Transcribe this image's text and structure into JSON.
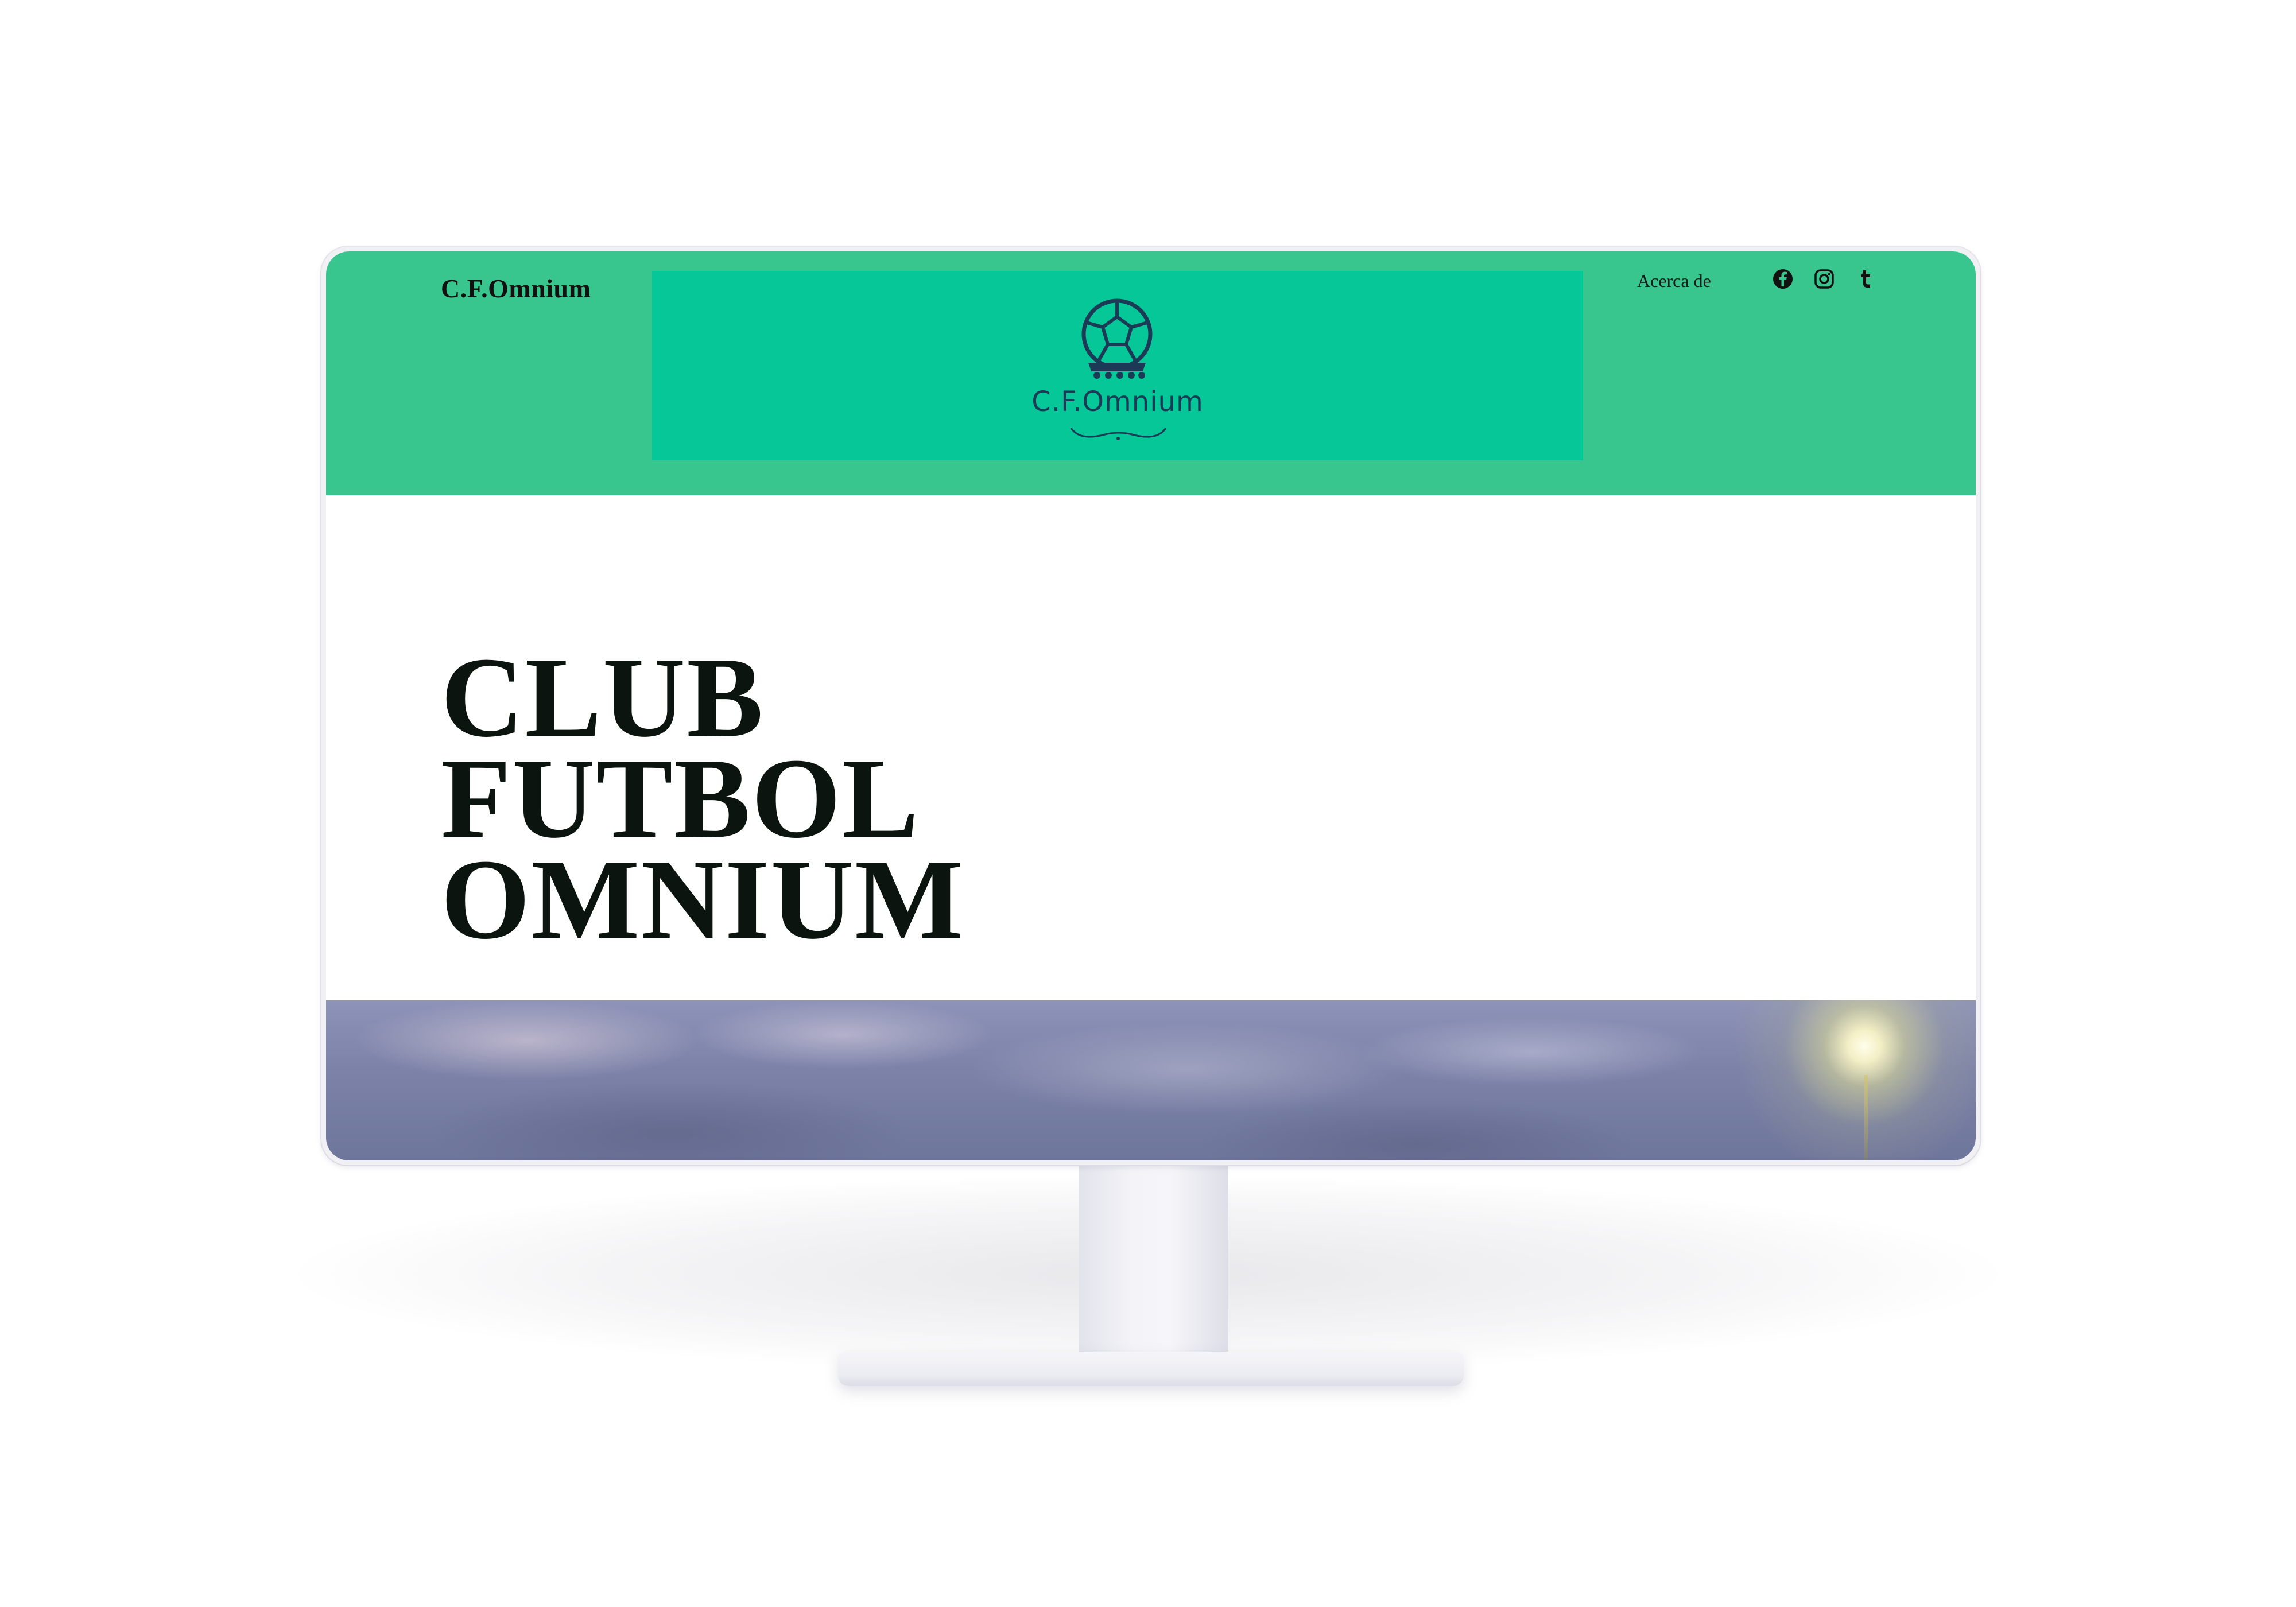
{
  "site": {
    "brand": "C.F.Omnium",
    "logo_text": "C.F.Omnium",
    "nav": {
      "about": "Acerca de"
    },
    "social": [
      "facebook-icon",
      "instagram-icon",
      "tumblr-icon"
    ]
  },
  "hero": {
    "line1": "CLUB",
    "line2": "FUTBOL",
    "line3": "OMNIUM"
  },
  "colors": {
    "header_green": "#39c68e",
    "logo_panel_green": "#06c798",
    "logo_navy": "#1b3a56",
    "title_dark": "#0b140f"
  }
}
